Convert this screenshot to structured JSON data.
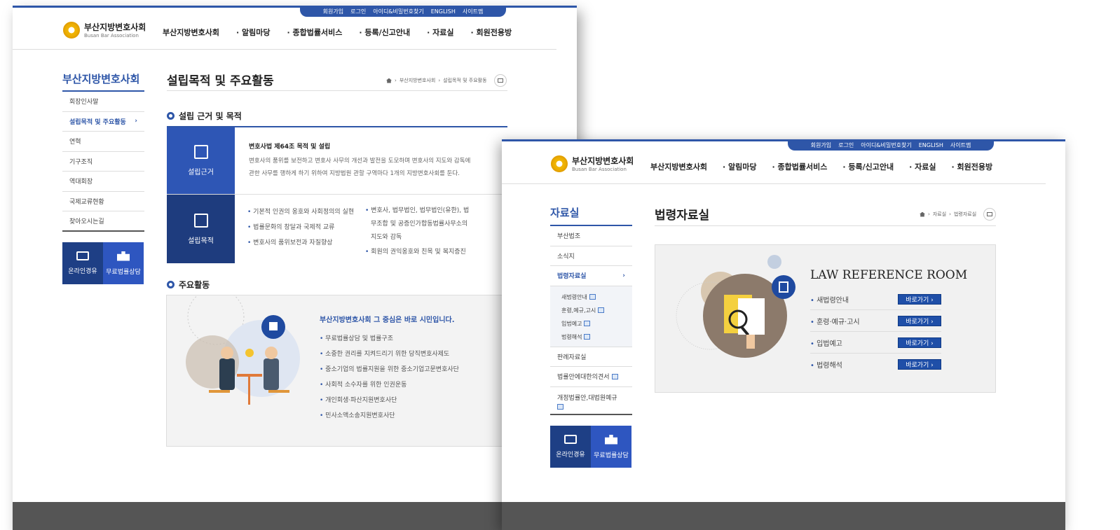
{
  "shared": {
    "util_links": [
      "회원가입",
      "로그인",
      "아이디&비밀번호찾기",
      "ENGLISH",
      "사이트맵"
    ],
    "logo_ko": "부산지방변호사회",
    "logo_en": "Busan Bar Association",
    "gnb": [
      "부산지방변호사회",
      "· 알림마당",
      "· 종합법률서비스",
      "· 등록/신고안내",
      "· 자료실",
      "· 회원전용방"
    ],
    "quick": {
      "online": "온라인경유",
      "free": "무료법률상담"
    },
    "colors": {
      "primary": "#2e56a8",
      "dark_navy": "#1e3f85",
      "footer": "#555555"
    }
  },
  "page_a": {
    "side_title": "부산지방변호사회",
    "side_items": [
      "회장인사말",
      "설립목적 및 주요활동",
      "연혁",
      "기구조직",
      "역대회장",
      "국제교류현황",
      "찾아오시는길"
    ],
    "active_index": 1,
    "page_title": "설립목적 및 주요활동",
    "breadcrumb": [
      "부산지방변호사회",
      "설립목적 및 주요활동"
    ],
    "section1": "설립 근거 및 목적",
    "basis": {
      "label": "설립근거",
      "heading": "변호사법 제64조 목적 및 설립",
      "lines": [
        "변호사의 품위를 보전하고 변호사 사무의 개선과 발전을 도모하며 변호사의 지도와 감독에",
        "관한 사무를 행하게 하기 위하여 지방법원 관할 구역마다 1개의 지방변호사회를 둔다."
      ]
    },
    "purpose": {
      "label": "설립목적",
      "left": [
        "기본적 인권의 옹호와 사회정의의 실현",
        "법률문화의 창달과 국제적 교류",
        "변호사의 품위보전과 자질향상"
      ],
      "right_1": [
        "변호사, 법무법인, 법무법인(유한), 법",
        "무조합 및 공증인가합동법률사무소의",
        "지도와 감독"
      ],
      "right_2": "회원의 권익옹호와 친목 및 복지증진"
    },
    "section2": "주요활동",
    "activities_heading": "부산지방변호사회 그 중심은 바로 시민입니다.",
    "activities": [
      "무료법률상담 및 법률구조",
      "소중한 권리를 지켜드리기 위한 당직변호사제도",
      "중소기업의 법률지원을 위한 중소기업고문변호사단",
      "사회적 소수자를 위한 인권운동",
      "개인회생·파산지원변호사단",
      "민사소액소송지원변호사단"
    ]
  },
  "page_b": {
    "side_title": "자료실",
    "side_items": [
      "부산법조",
      "소식지",
      "법령자료실",
      "판례자료실",
      "법률안에대한의견서",
      "개정법률안,대법원예규"
    ],
    "active_index": 2,
    "sub_items": [
      "새법령안내",
      "훈령,예규,고시",
      "입법예고",
      "법령해석"
    ],
    "page_title": "법령자료실",
    "breadcrumb": [
      "자료실",
      "법령자료실"
    ],
    "law_title": "LAW REFERENCE ROOM",
    "law_items": [
      "새법령안내",
      "훈령·예규·고시",
      "입법예고",
      "법령해석"
    ],
    "go_label": "바로가기 ›"
  }
}
